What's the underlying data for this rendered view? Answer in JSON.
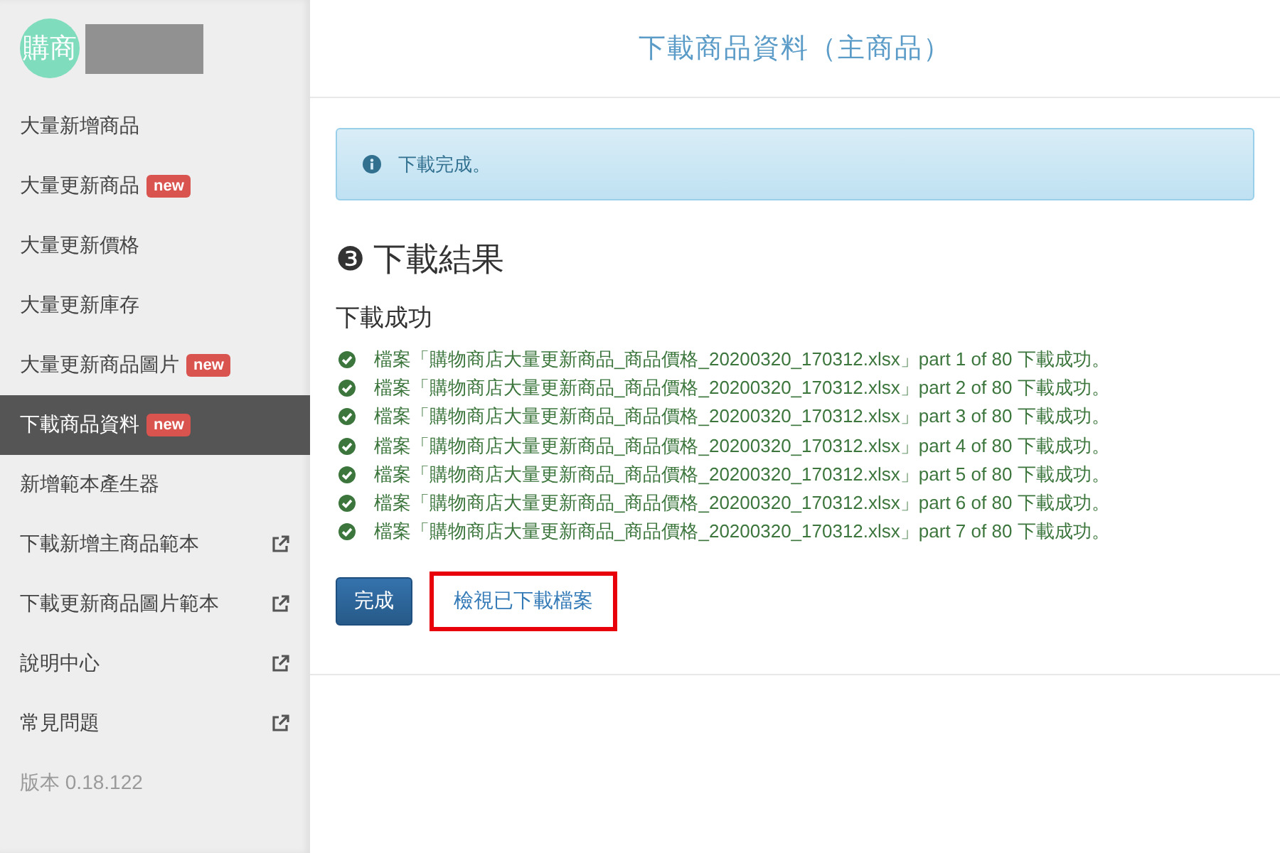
{
  "sidebar": {
    "logo": "購商",
    "items": [
      {
        "label": "大量新增商品",
        "external": false,
        "selected": false
      },
      {
        "label": "大量更新商品",
        "badge": "new",
        "external": false,
        "selected": false
      },
      {
        "label": "大量更新價格",
        "external": false,
        "selected": false
      },
      {
        "label": "大量更新庫存",
        "external": false,
        "selected": false
      },
      {
        "label": "大量更新商品圖片",
        "badge": "new",
        "external": false,
        "selected": false
      },
      {
        "label": "下載商品資料",
        "badge": "new",
        "external": false,
        "selected": true
      },
      {
        "label": "新增範本產生器",
        "external": false,
        "selected": false
      },
      {
        "label": "下載新增主商品範本",
        "external": true,
        "selected": false
      },
      {
        "label": "下載更新商品圖片範本",
        "external": true,
        "selected": false
      },
      {
        "label": "說明中心",
        "external": true,
        "selected": false
      },
      {
        "label": "常見問題",
        "external": true,
        "selected": false
      }
    ],
    "version": "版本 0.18.122"
  },
  "page_title": "下載商品資料（主商品）",
  "alert": "下載完成。",
  "step": {
    "number": "❸",
    "title": "下載結果"
  },
  "success_heading": "下載成功",
  "results": [
    "檔案「購物商店大量更新商品_商品價格_20200320_170312.xlsx」part 1 of 80 下載成功。",
    "檔案「購物商店大量更新商品_商品價格_20200320_170312.xlsx」part 2 of 80 下載成功。",
    "檔案「購物商店大量更新商品_商品價格_20200320_170312.xlsx」part 3 of 80 下載成功。",
    "檔案「購物商店大量更新商品_商品價格_20200320_170312.xlsx」part 4 of 80 下載成功。",
    "檔案「購物商店大量更新商品_商品價格_20200320_170312.xlsx」part 5 of 80 下載成功。",
    "檔案「購物商店大量更新商品_商品價格_20200320_170312.xlsx」part 6 of 80 下載成功。",
    "檔案「購物商店大量更新商品_商品價格_20200320_170312.xlsx」part 7 of 80 下載成功。"
  ],
  "done_button": "完成",
  "view_link": {
    "label": "檢視已下載檔案",
    "highlighted": true
  }
}
